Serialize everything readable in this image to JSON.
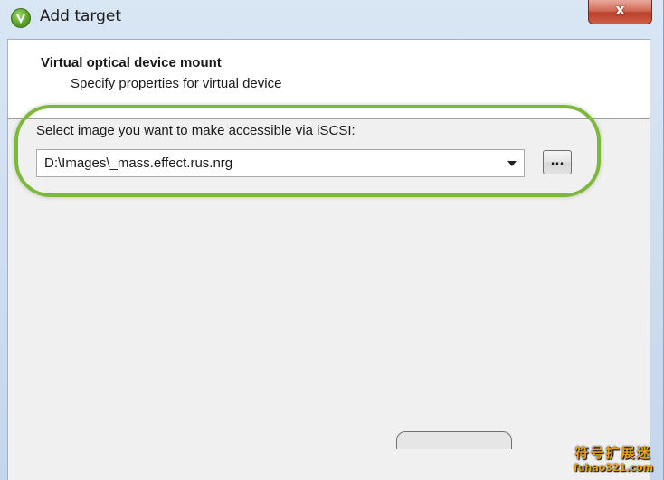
{
  "window": {
    "title": "Add target",
    "close_label": "x"
  },
  "header": {
    "title": "Virtual optical device mount",
    "subtitle": "Specify properties for virtual device"
  },
  "form": {
    "image_label": "Select image you want to make accessible via iSCSI:",
    "image_value": "D:\\Images\\_mass.effect.rus.nrg",
    "browse_label": "..."
  },
  "watermark": {
    "line1": "符号扩展迷",
    "line2": "fuhao321.com"
  },
  "colors": {
    "highlight": "#7db83a",
    "close_button": "#c9533d",
    "header_bg": "#ffffff",
    "body_bg": "#f0f0f0"
  },
  "icons": {
    "app": "green-shield-icon",
    "dropdown": "chevron-down-icon"
  }
}
